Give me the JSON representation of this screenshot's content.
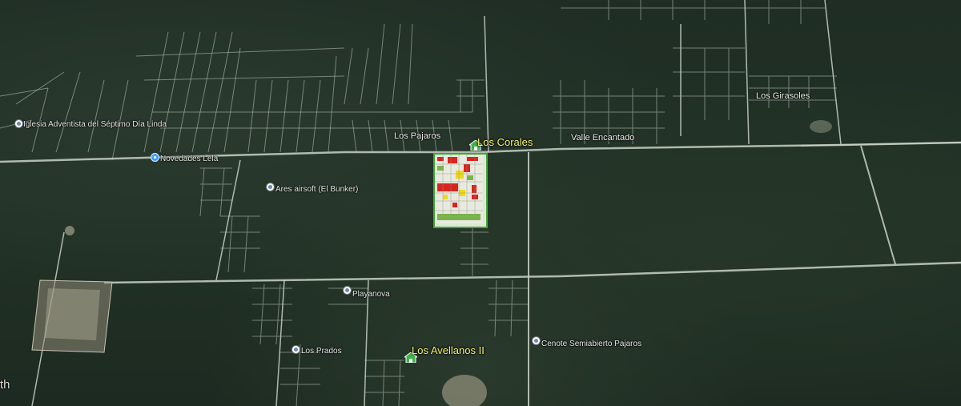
{
  "map": {
    "places": [
      {
        "label": "Los Corales",
        "style": "big",
        "icon": "house-icon"
      },
      {
        "label": "Los Avellanos II",
        "style": "big",
        "icon": "house-icon"
      },
      {
        "label": "Los Pajaros",
        "style": "med"
      },
      {
        "label": "Valle Encantado",
        "style": "med"
      },
      {
        "label": "Los Girasoles",
        "style": "med"
      }
    ],
    "pois": [
      {
        "label": "Iglesia Adventista del Séptimo Día Linda",
        "icon": "church-icon"
      },
      {
        "label": "Novedades Lela",
        "icon": "shop-icon"
      },
      {
        "label": "Ares airsoft (El Bunker)",
        "icon": "poi-icon"
      },
      {
        "label": "Playanova",
        "icon": "poi-icon"
      },
      {
        "label": "Los Prados",
        "icon": "poi-icon"
      },
      {
        "label": "Cenote Semiabierto Pajaros",
        "icon": "cenote-icon"
      }
    ],
    "edge_text": "th",
    "colors": {
      "highlight": "#3eaa2f",
      "place_label": "#f3f26a",
      "road": "#cfd6cc"
    }
  }
}
